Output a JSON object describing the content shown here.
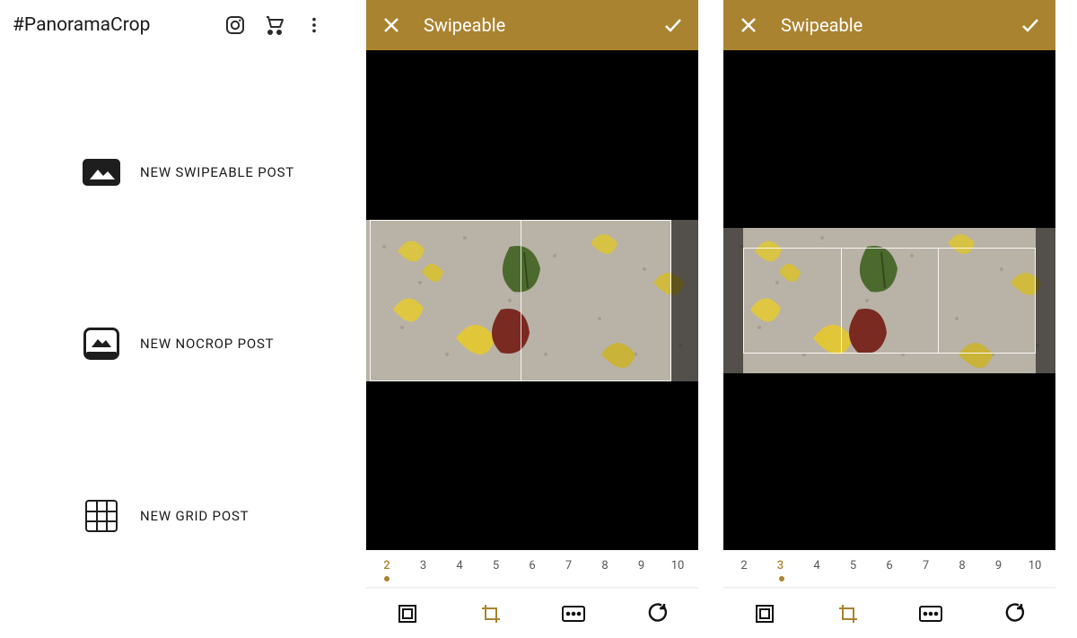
{
  "colors": {
    "accent": "#aa8330",
    "text": "#1a1a1a",
    "canvas_bg": "#000000"
  },
  "menu": {
    "title": "#PanoramaCrop",
    "header_icons": {
      "instagram": "instagram-icon",
      "cart": "cart-icon",
      "more": "more-icon"
    },
    "items": [
      {
        "icon": "swipeable-icon",
        "label": "NEW SWIPEABLE POST"
      },
      {
        "icon": "nocrop-icon",
        "label": "NEW NOCROP POST"
      },
      {
        "icon": "grid-icon",
        "label": "NEW GRID POST"
      }
    ]
  },
  "editor": {
    "title": "Swipeable",
    "ruler_values": [
      2,
      3,
      4,
      5,
      6,
      7,
      8,
      9,
      10
    ],
    "toolbar": {
      "buttons": [
        {
          "name": "frame-icon",
          "active": false
        },
        {
          "name": "crop-icon",
          "active": true
        },
        {
          "name": "aspect-icon",
          "active": false
        },
        {
          "name": "rotate-icon",
          "active": false
        }
      ]
    }
  },
  "screens": [
    {
      "selected_slices": 2
    },
    {
      "selected_slices": 3
    }
  ]
}
